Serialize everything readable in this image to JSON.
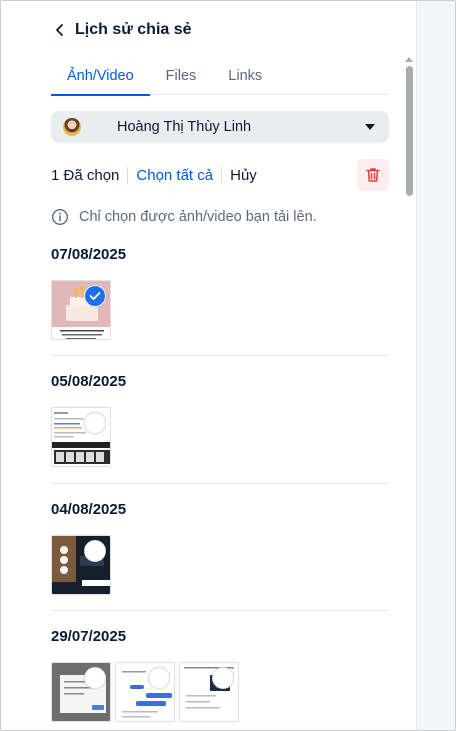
{
  "header": {
    "title": "Lịch sử chia sẻ"
  },
  "tabs": [
    {
      "label": "Ảnh/Video",
      "active": true
    },
    {
      "label": "Files",
      "active": false
    },
    {
      "label": "Links",
      "active": false
    }
  ],
  "member_filter": {
    "selected": "Hoàng Thị Thùy Linh"
  },
  "selection": {
    "count_label": "1 Đã chọn",
    "select_all_label": "Chọn tất cả",
    "cancel_label": "Hủy"
  },
  "notice": "Chỉ chọn được ảnh/video bạn tải lên.",
  "groups": [
    {
      "date": "07/08/2025",
      "items": [
        {
          "kind": "birthday-cake",
          "selected": true
        }
      ]
    },
    {
      "date": "05/08/2025",
      "items": [
        {
          "kind": "document-screenshot",
          "selected": false
        }
      ]
    },
    {
      "date": "04/08/2025",
      "items": [
        {
          "kind": "dark-screenshot",
          "selected": false
        }
      ]
    },
    {
      "date": "29/07/2025",
      "items": [
        {
          "kind": "gray-screenshot",
          "selected": false
        },
        {
          "kind": "chat-screenshot",
          "selected": false
        },
        {
          "kind": "chat-screenshot-2",
          "selected": false
        }
      ]
    }
  ],
  "colors": {
    "accent": "#005ae0",
    "check": "#1e6ff0",
    "danger": "#e03c3c"
  },
  "icons": [
    "back-icon",
    "chevron-down-icon",
    "trash-icon",
    "info-icon",
    "check-icon"
  ]
}
